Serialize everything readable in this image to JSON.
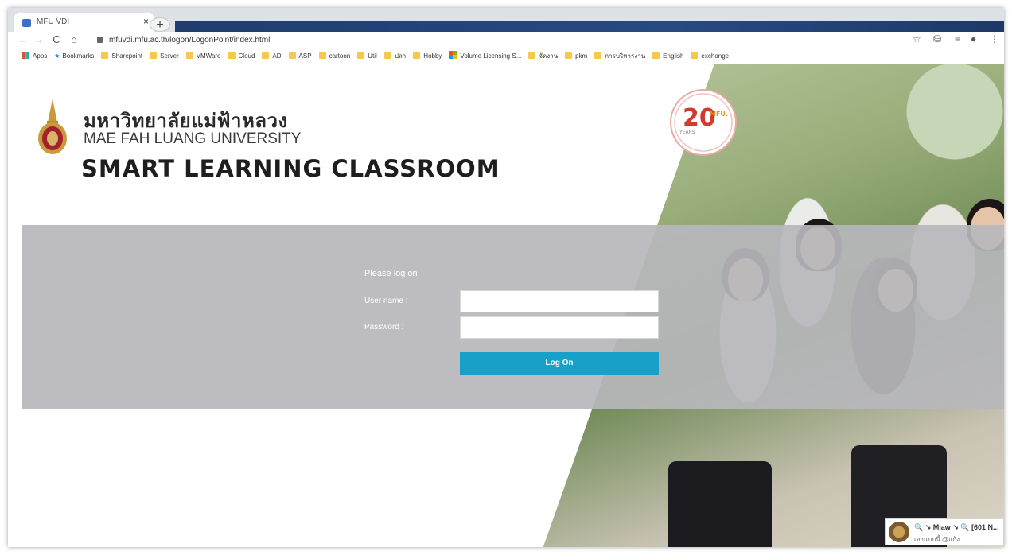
{
  "browser": {
    "tab_title": "MFU VDI",
    "tab_close": "×",
    "new_tab": "+",
    "url": "mfuvdi.mfu.ac.th/logon/LogonPoint/index.html",
    "nav": {
      "back": "←",
      "forward": "→",
      "reload": "C",
      "home": "⌂"
    },
    "toolbar_icons": [
      "star-icon",
      "extension-icon",
      "reading-list-icon",
      "profile-icon",
      "menu-icon"
    ],
    "toolbar_glyphs": {
      "star": "☆",
      "ext": "⛁",
      "list": "≡",
      "profile": "●",
      "menu": "⋮"
    }
  },
  "bookmarks": [
    {
      "label": "Apps",
      "icon": "apps-grid"
    },
    {
      "label": "Bookmarks",
      "icon": "star"
    },
    {
      "label": "Sharepoint",
      "icon": "folder"
    },
    {
      "label": "Server",
      "icon": "folder"
    },
    {
      "label": "VMWare",
      "icon": "folder"
    },
    {
      "label": "Cloud",
      "icon": "folder"
    },
    {
      "label": "AD",
      "icon": "folder"
    },
    {
      "label": "ASP",
      "icon": "folder"
    },
    {
      "label": "cartoon",
      "icon": "folder"
    },
    {
      "label": "Util",
      "icon": "folder"
    },
    {
      "label": "ปลา",
      "icon": "folder"
    },
    {
      "label": "Hobby",
      "icon": "folder"
    },
    {
      "label": "Volume Licensing S...",
      "icon": "windows"
    },
    {
      "label": "จัดงาน",
      "icon": "folder"
    },
    {
      "label": "pkm",
      "icon": "folder"
    },
    {
      "label": "การบริหารงาน",
      "icon": "folder"
    },
    {
      "label": "English",
      "icon": "folder"
    },
    {
      "label": "exchange",
      "icon": "folder"
    }
  ],
  "branding": {
    "thai_name": "มหาวิทยาลัยแม่ฟ้าหลวง",
    "english_name": "MAE FAH LUANG UNIVERSITY",
    "product_title": "SMART LEARNING CLASSROOM",
    "anniversary": {
      "number": "20",
      "tag": "MFU.",
      "years_label": "YEARS"
    }
  },
  "login": {
    "heading": "Please log on",
    "username_label": "User name :",
    "username_value": "",
    "password_label": "Password :",
    "password_value": "",
    "submit_label": "Log On"
  },
  "notification": {
    "title": "🔍 ↘ Miaw ↘ 🔍 [601 N...",
    "subtitle": "เอาแบบนี้ @แก้ง"
  },
  "colors": {
    "login_button": "#17a1c9",
    "login_band": "#b7b7bc",
    "tab_strip": "#dee1e6"
  }
}
